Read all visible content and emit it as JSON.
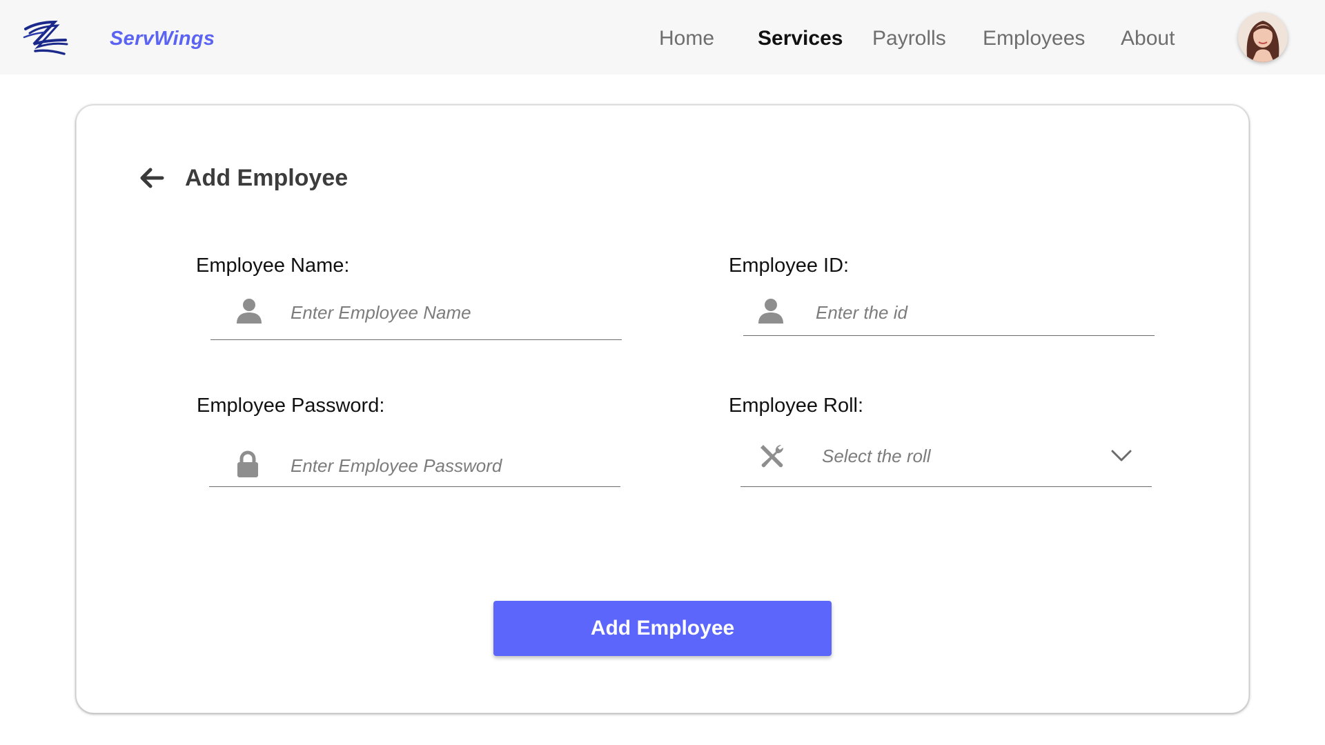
{
  "header": {
    "brand": "ServWings",
    "nav": [
      {
        "label": "Home",
        "active": false
      },
      {
        "label": "Services",
        "active": true
      },
      {
        "label": "Payrolls",
        "active": false
      },
      {
        "label": "Employees",
        "active": false
      },
      {
        "label": "About",
        "active": false
      }
    ]
  },
  "card": {
    "title": "Add Employee",
    "fields": {
      "name": {
        "label": "Employee Name:",
        "placeholder": "Enter Employee Name",
        "icon": "user-icon"
      },
      "id": {
        "label": "Employee ID:",
        "placeholder": "Enter the id",
        "icon": "user-icon"
      },
      "password": {
        "label": "Employee Password:",
        "placeholder": "Enter Employee Password",
        "icon": "lock-icon"
      },
      "roll": {
        "label": "Employee Roll:",
        "placeholder": "Select the roll",
        "icon": "tools-icon"
      }
    },
    "submit_label": "Add Employee"
  },
  "colors": {
    "brand": "#5b63f2",
    "button": "#5c66fb",
    "header_bg": "#f7f7f7"
  }
}
